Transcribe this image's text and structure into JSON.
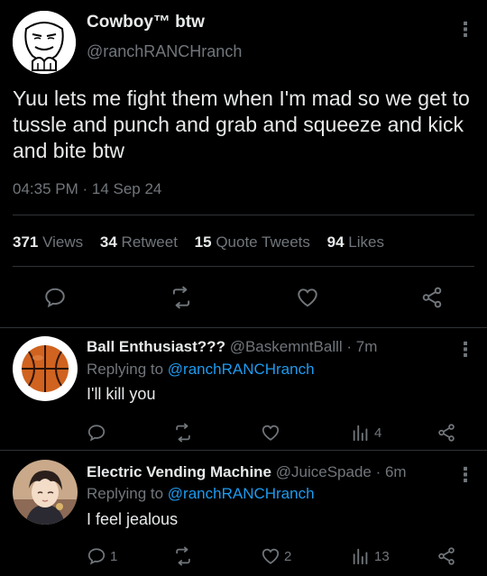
{
  "tweet": {
    "display_name": "Cowboy™ btw",
    "handle": "@ranchRANCHranch",
    "text": "Yuu lets me fight them when I'm mad so we get to tussle and punch and grab and squeeze and kick and bite btw",
    "timestamp": "04:35 PM · 14 Sep 24",
    "stats": {
      "views_count": "371",
      "views_label": "Views",
      "retweet_count": "34",
      "retweet_label": "Retweet",
      "quote_count": "15",
      "quote_label": "Quote Tweets",
      "likes_count": "94",
      "likes_label": "Likes"
    },
    "more_icon": "more-vertical-icon"
  },
  "replies": [
    {
      "display_name": "Ball Enthusiast???",
      "handle": "@BaskemntBalll",
      "time": "· 7m",
      "replying_prefix": "Replying to",
      "replying_to": "@ranchRANCHranch",
      "text": "I'll kill you",
      "reply_count": "",
      "retweet_count": "",
      "like_count": "",
      "views_count": "4",
      "avatar": "basketball-avatar"
    },
    {
      "display_name": "Electric Vending Machine",
      "handle": "@JuiceSpade",
      "time": "· 6m",
      "replying_prefix": "Replying to",
      "replying_to": "@ranchRANCHranch",
      "text": "I feel jealous",
      "reply_count": "1",
      "retweet_count": "",
      "like_count": "2",
      "views_count": "13",
      "avatar": "anime-character-avatar"
    }
  ],
  "colors": {
    "background": "#000000",
    "text": "#e7e9ea",
    "muted": "#71767b",
    "link": "#1d9bf0",
    "divider": "#2f3336"
  }
}
